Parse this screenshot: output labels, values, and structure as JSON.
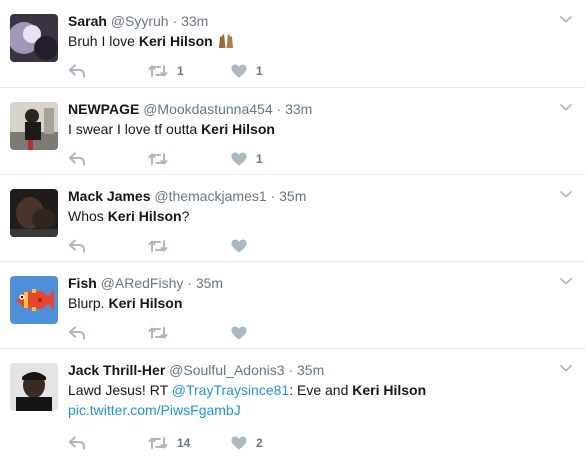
{
  "tweets": [
    {
      "name": "Sarah",
      "handle": "@Syyruh",
      "time": "33m",
      "text": {
        "pre": "Bruh I love ",
        "bold": "Keri Hilson",
        "post": " "
      },
      "retweets": "1",
      "likes": "1"
    },
    {
      "name": "NEWPAGE",
      "handle": "@Mookdastunna454",
      "time": "33m",
      "text": {
        "pre": "I swear I love tf outta ",
        "bold": "Keri Hilson",
        "post": ""
      },
      "retweets": "",
      "likes": "1"
    },
    {
      "name": "Mack James",
      "handle": "@themackjames1",
      "time": "35m",
      "text": {
        "pre": "Whos ",
        "bold": "Keri Hilson",
        "post": "?"
      },
      "retweets": "",
      "likes": ""
    },
    {
      "name": "Fish",
      "handle": "@ARedFishy",
      "time": "35m",
      "text": {
        "pre": "Blurp. ",
        "bold": "Keri Hilson",
        "post": ""
      },
      "retweets": "",
      "likes": ""
    },
    {
      "name": "Jack Thrill-Her",
      "handle": "@Soulful_Adonis3",
      "time": "35m",
      "text": {
        "pre": "Lawd Jesus! RT ",
        "mention": "@TrayTraysince81",
        "mid": ": Eve and ",
        "bold": "Keri Hilson",
        "post": "",
        "link": "pic.twitter.com/PiwsFgambJ"
      },
      "retweets": "14",
      "likes": "2"
    }
  ],
  "separator": "·",
  "icons": {
    "reply": "reply-icon",
    "retweet": "retweet-icon",
    "like": "heart-icon",
    "menu": "chevron-down-icon",
    "emoji": "raising-hands-emoji"
  },
  "colors": {
    "text": "#14171a",
    "muted": "#657786",
    "icon": "#aab8c2",
    "link": "#1b95e0",
    "divider": "#e6ecf0"
  }
}
